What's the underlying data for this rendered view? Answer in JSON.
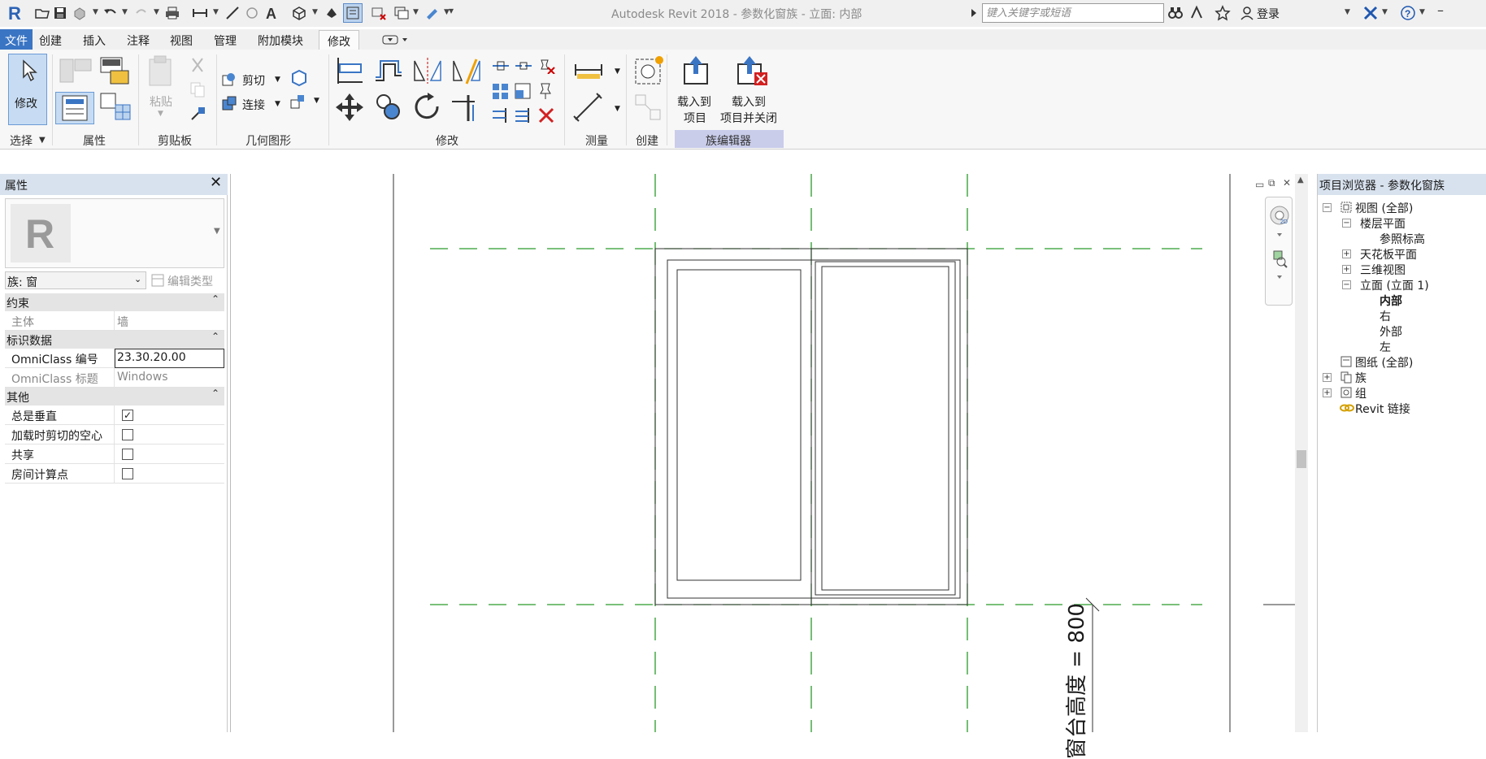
{
  "app": {
    "title": "Autodesk Revit 2018 -    参数化窗族 - 立面: 内部",
    "search_placeholder": "键入关键字或短语",
    "login_label": "登录",
    "accent_color": "#3a75c4"
  },
  "tabs": [
    {
      "label": "文件"
    },
    {
      "label": "创建"
    },
    {
      "label": "插入"
    },
    {
      "label": "注释"
    },
    {
      "label": "视图"
    },
    {
      "label": "管理"
    },
    {
      "label": "附加模块"
    },
    {
      "label": "修改"
    }
  ],
  "ribbon": {
    "modify_label": "修改",
    "cut_label": "剪切",
    "join_label": "连接",
    "paste_label": "粘贴",
    "load_into_project_line1": "载入到",
    "load_into_project_line2": "项目",
    "load_close_line1": "载入到",
    "load_close_line2": "项目并关闭",
    "panels": {
      "select": "选择",
      "properties": "属性",
      "clipboard": "剪贴板",
      "geometry": "几何图形",
      "modify": "修改",
      "measure": "测量",
      "create": "创建",
      "family_editor": "族编辑器"
    }
  },
  "properties": {
    "title": "属性",
    "type_selector": "族: 窗",
    "edit_type": "编辑类型",
    "groups": {
      "constraints": "约束",
      "identity": "标识数据",
      "other": "其他"
    },
    "rows": {
      "host_key": "主体",
      "host_value": "墙",
      "omniclass_number_key": "OmniClass 编号",
      "omniclass_number_value": "23.30.20.00",
      "omniclass_title_key": "OmniClass 标题",
      "omniclass_title_value": "Windows",
      "always_vertical": "总是垂直",
      "always_vertical_checked": "✓",
      "cut_void": "加载时剪切的空心",
      "shared": "共享",
      "room_calc": "房间计算点"
    }
  },
  "canvas": {
    "dimension_label": "窗台高度 = 800"
  },
  "browser": {
    "title": "项目浏览器 - 参数化窗族",
    "items": {
      "views_all": "视图 (全部)",
      "floor_plans": "楼层平面",
      "ref_level": "参照标高",
      "ceiling_plans": "天花板平面",
      "views_3d": "三维视图",
      "elevations": "立面 (立面 1)",
      "interior": "内部",
      "right": "右",
      "exterior": "外部",
      "left": "左",
      "sheets": "图纸 (全部)",
      "families": "族",
      "groups": "组",
      "revit_links": "Revit 链接"
    }
  }
}
